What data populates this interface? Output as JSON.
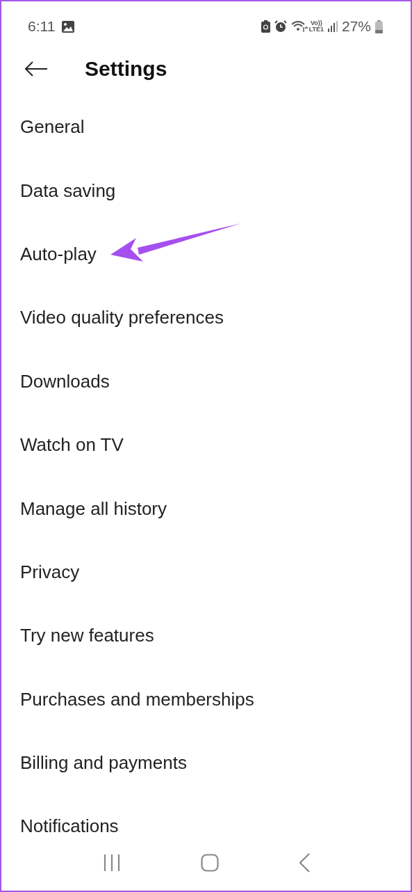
{
  "status_bar": {
    "time": "6:11",
    "network_top": "Vo))",
    "network_bottom": "LTE1",
    "battery": "27%"
  },
  "header": {
    "title": "Settings"
  },
  "items": [
    {
      "label": "General"
    },
    {
      "label": "Data saving"
    },
    {
      "label": "Auto-play"
    },
    {
      "label": "Video quality preferences"
    },
    {
      "label": "Downloads"
    },
    {
      "label": "Watch on TV"
    },
    {
      "label": "Manage all history"
    },
    {
      "label": "Privacy"
    },
    {
      "label": "Try new features"
    },
    {
      "label": "Purchases and memberships"
    },
    {
      "label": "Billing and payments"
    },
    {
      "label": "Notifications"
    }
  ]
}
